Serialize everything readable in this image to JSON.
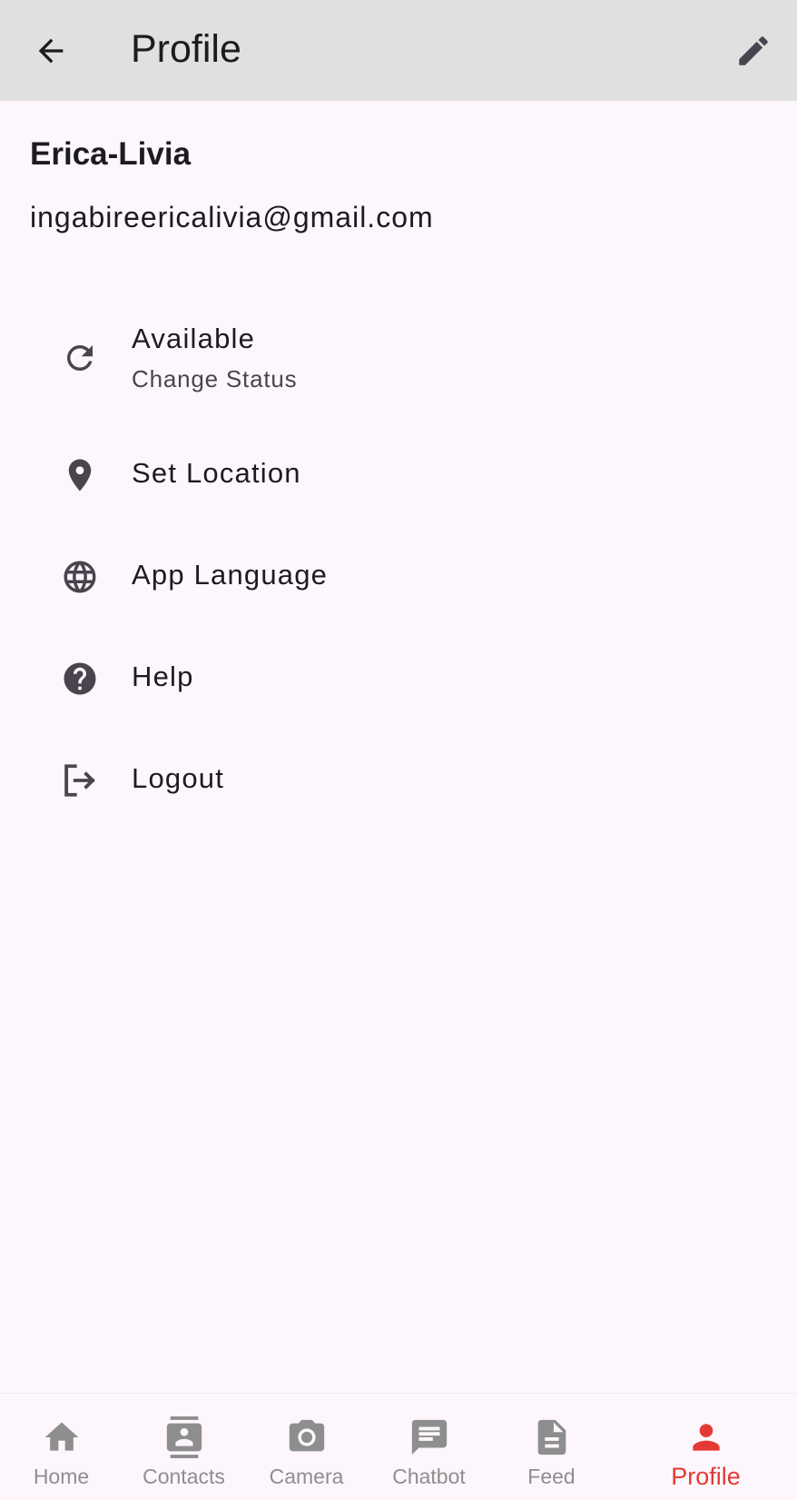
{
  "appbar": {
    "title": "Profile"
  },
  "user": {
    "name": "Erica-Livia",
    "email": "ingabireericalivia@gmail.com"
  },
  "menu": [
    {
      "label": "Available",
      "sublabel": "Change Status",
      "icon": "refresh-icon"
    },
    {
      "label": "Set Location",
      "icon": "location-pin-icon"
    },
    {
      "label": "App Language",
      "icon": "globe-icon"
    },
    {
      "label": "Help",
      "icon": "help-icon"
    },
    {
      "label": "Logout",
      "icon": "logout-icon"
    }
  ],
  "nav": [
    {
      "label": "Home",
      "icon": "home-icon"
    },
    {
      "label": "Contacts",
      "icon": "contacts-icon"
    },
    {
      "label": "Camera",
      "icon": "camera-icon"
    },
    {
      "label": "Chatbot",
      "icon": "chat-icon"
    },
    {
      "label": "Feed",
      "icon": "feed-icon"
    },
    {
      "label": "Profile",
      "icon": "person-icon",
      "active": true
    }
  ],
  "colors": {
    "accent": "#e53935",
    "appbar": "#e0e0e0",
    "background": "#fdf7fd",
    "icon": "#49454f",
    "inactive": "#8e8e8e"
  }
}
